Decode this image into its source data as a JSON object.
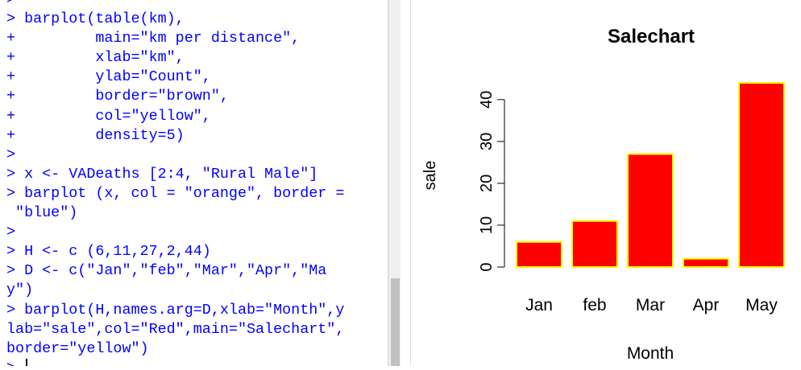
{
  "console": {
    "lines": [
      ">",
      "> barplot(table(km),",
      "+         main=\"km per distance\",",
      "+         xlab=\"km\",",
      "+         ylab=\"Count\",",
      "+         border=\"brown\",",
      "+         col=\"yellow\",",
      "+         density=5)",
      ">",
      "> x <- VADeaths [2:4, \"Rural Male\"]",
      "> barplot (x, col = \"orange\", border =",
      " \"blue\")",
      ">",
      "> H <- c (6,11,27,2,44)",
      "> D <- c(\"Jan\",\"feb\",\"Mar\",\"Apr\",\"Ma",
      "y\")",
      "> barplot(H,names.arg=D,xlab=\"Month\",y",
      "lab=\"sale\",col=\"Red\",main=\"Salechart\",",
      "border=\"yellow\")",
      "> "
    ],
    "text_color": "#0000ff"
  },
  "chart_data": {
    "type": "bar",
    "title": "Salechart",
    "xlabel": "Month",
    "ylabel": "sale",
    "categories": [
      "Jan",
      "feb",
      "Mar",
      "Apr",
      "May"
    ],
    "values": [
      6,
      11,
      27,
      2,
      44
    ],
    "y_ticks": [
      "0",
      "10",
      "20",
      "30",
      "40"
    ],
    "ylim": [
      0,
      44
    ],
    "bar_color": "#ff0000",
    "border_color": "#ffff00",
    "grid": false,
    "legend": "none"
  }
}
